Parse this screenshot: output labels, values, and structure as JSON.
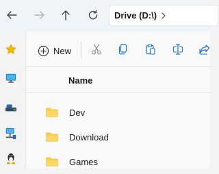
{
  "nav": {
    "back_icon": "arrow-left-icon",
    "forward_icon": "arrow-right-icon",
    "up_icon": "arrow-up-icon",
    "refresh_icon": "refresh-icon"
  },
  "address": {
    "crumb": "Drive (D:\\)",
    "separator_icon": "chevron-right-icon"
  },
  "rail": {
    "items": [
      {
        "icon": "star-icon",
        "color": "#f2b705"
      },
      {
        "icon": "monitor-icon",
        "color": "#1e88c9"
      },
      {
        "icon": "drive-icon",
        "color": "#2b6cb0"
      },
      {
        "icon": "network-icon",
        "color": "#1e88c9"
      },
      {
        "icon": "linux-penguin-icon",
        "color": "#222222"
      }
    ]
  },
  "toolbar": {
    "new_label": "New",
    "new_icon": "plus-circle-icon",
    "cut_icon": "scissors-icon",
    "copy_icon": "copy-icon",
    "paste_icon": "paste-icon",
    "rename_icon": "rename-icon",
    "share_icon": "share-icon",
    "accent": "#1a73c8"
  },
  "list": {
    "column_name": "Name",
    "rows": [
      {
        "name": "Dev",
        "icon": "folder-icon"
      },
      {
        "name": "Download",
        "icon": "folder-icon"
      },
      {
        "name": "Games",
        "icon": "folder-icon"
      }
    ],
    "folder_color": "#f7c948"
  }
}
